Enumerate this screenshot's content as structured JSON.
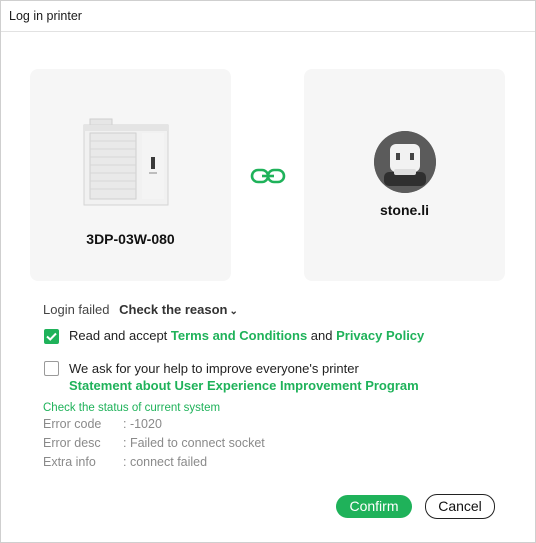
{
  "window": {
    "title": "Log in printer"
  },
  "printer": {
    "name": "3DP-03W-080"
  },
  "user": {
    "name": "stone.li"
  },
  "login": {
    "failed_label": "Login failed",
    "reason_link": "Check the reason",
    "reason_chevron": "v"
  },
  "terms": {
    "checked": true,
    "prefix": "Read and accept ",
    "terms_link": "Terms and Conditions",
    "and": " and ",
    "privacy_link": "Privacy Policy"
  },
  "improve": {
    "checked": false,
    "text": "We ask for your help to improve everyone's printer",
    "link": "Statement about User Experience Improvement Program"
  },
  "system_status": {
    "title": "Check the status of current system",
    "rows": [
      {
        "key": "Error code",
        "value": ": -1020"
      },
      {
        "key": "Error desc",
        "value": ": Failed to connect socket"
      },
      {
        "key": "Extra info",
        "value": ": connect failed"
      }
    ]
  },
  "buttons": {
    "confirm": "Confirm",
    "cancel": "Cancel"
  },
  "colors": {
    "accent": "#1fb25a"
  },
  "icons": {
    "link": "link-icon",
    "printer": "printer-image",
    "avatar": "robot-avatar"
  }
}
